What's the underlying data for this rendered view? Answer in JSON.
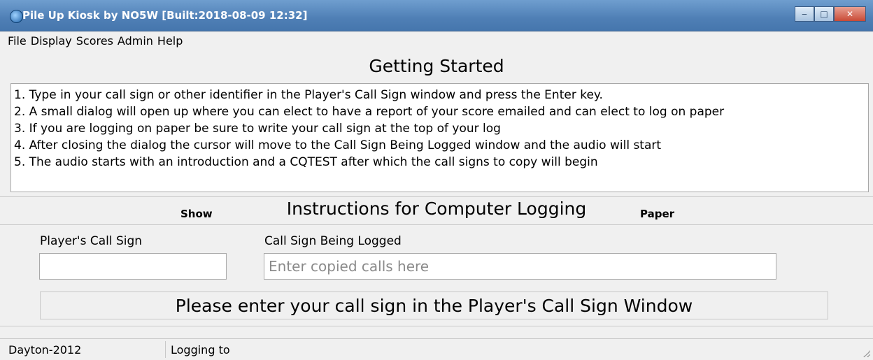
{
  "window": {
    "title": "Pile Up Kiosk by NO5W [Built:2018-08-09 12:32]",
    "buttons": {
      "minimize": "‒",
      "maximize": "□",
      "close": "✕"
    }
  },
  "menu": {
    "items": [
      {
        "label": "File"
      },
      {
        "label": "Display"
      },
      {
        "label": "Scores"
      },
      {
        "label": "Admin"
      },
      {
        "label": "Help"
      }
    ]
  },
  "getting_started": {
    "title": "Getting Started",
    "lines": [
      "1. Type in your call sign or other identifier in the Player's Call Sign window and press the Enter key.",
      "2. A small dialog will open up where you can elect to have a report of your score emailed and can elect to log on paper",
      "3. If you are logging on paper be sure to write your call sign at the top of your log",
      "4. After closing the dialog the cursor will move to the Call Sign Being Logged window and the audio will start",
      "5. The audio starts with an introduction and a CQTEST after which the call signs to copy will begin"
    ]
  },
  "instructions_bar": {
    "show_label": "Show",
    "title": "Instructions for Computer Logging",
    "paper_label": "Paper"
  },
  "fields": {
    "player_call_sign": {
      "label": "Player's Call Sign",
      "value": "",
      "placeholder": ""
    },
    "call_sign_logged": {
      "label": "Call Sign Being Logged",
      "value": "",
      "placeholder": "Enter copied calls here"
    }
  },
  "status_message": "Please enter your call sign in the Player's Call Sign Window",
  "statusbar": {
    "contest": "Dayton-2012",
    "logging": "Logging to"
  },
  "colors": {
    "titlebar": "#4f7fb5",
    "background": "#f0f0f0",
    "close_button": "#c94a36"
  }
}
